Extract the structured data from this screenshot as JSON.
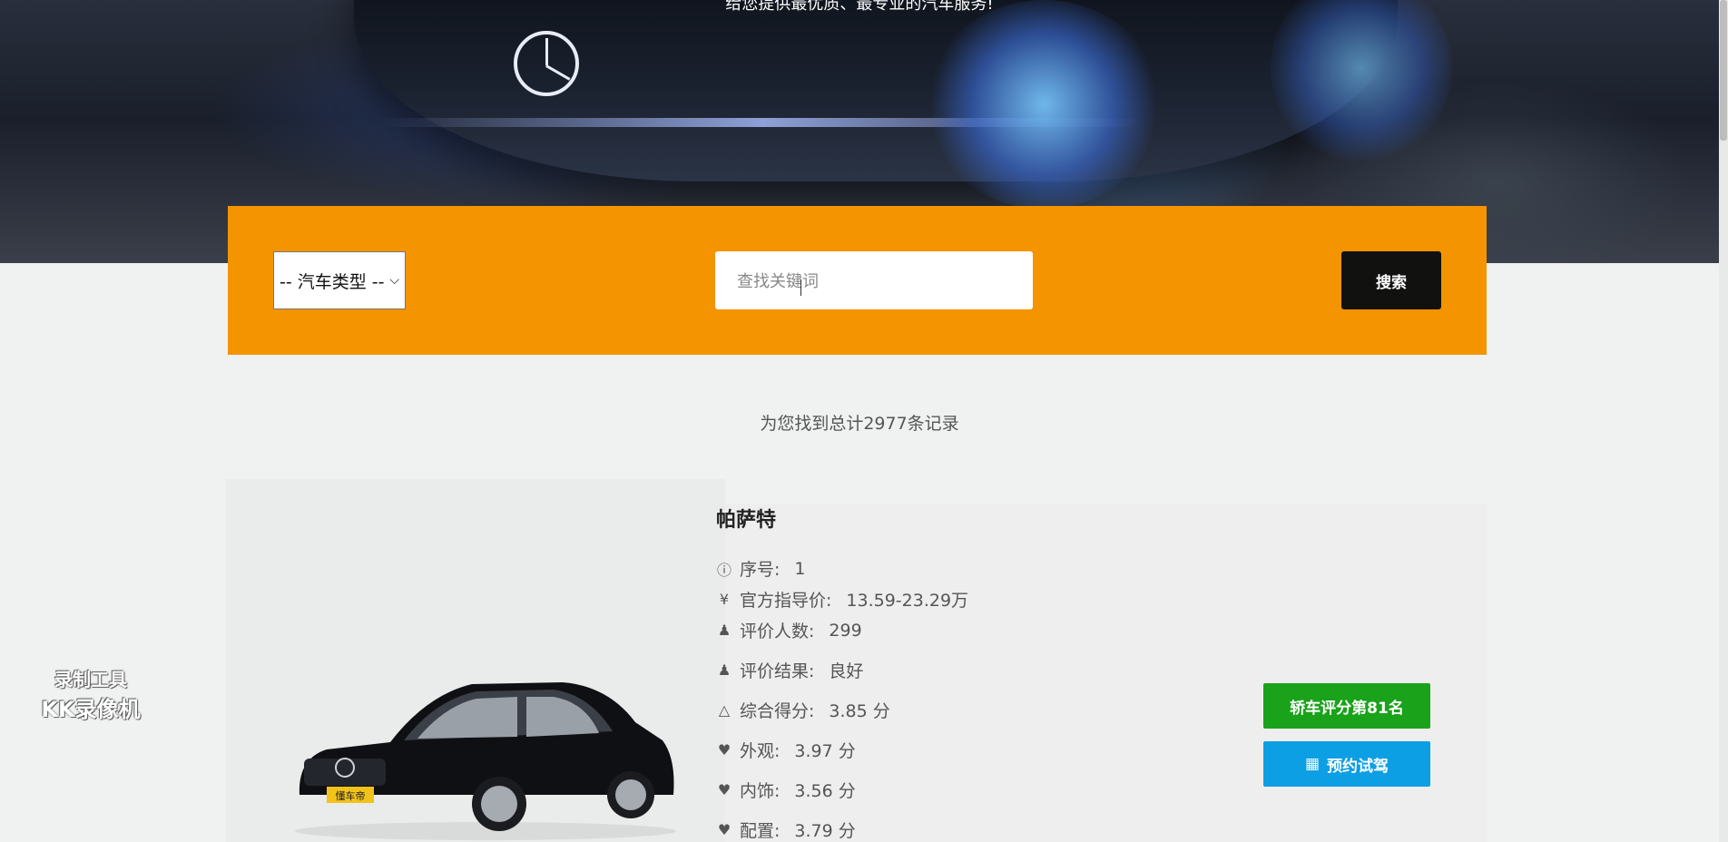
{
  "hero": {
    "subtitle": "给您提供最优质、最专业的汽车服务!"
  },
  "search": {
    "type_select": "-- 汽车类型 --",
    "keyword_placeholder": "查找关键词",
    "button_label": "搜索"
  },
  "result": {
    "count_text": "为您找到总计2977条记录"
  },
  "card": {
    "name": "帕萨特",
    "rows": [
      {
        "icon": "info-icon",
        "label": "序号:",
        "value": "1"
      },
      {
        "icon": "yen-icon",
        "label": "官方指导价:",
        "value": "13.59-23.29万"
      },
      {
        "icon": "user-icon",
        "label": "评价人数:",
        "value": "299"
      },
      {
        "icon": "user-icon",
        "label": "评价结果:",
        "value": "良好"
      },
      {
        "icon": "graduation-cap-icon",
        "label": "综合得分:",
        "value": "3.85 分"
      },
      {
        "icon": "heart-icon",
        "label": "外观:",
        "value": "3.97 分"
      },
      {
        "icon": "heart-icon",
        "label": "内饰:",
        "value": "3.56 分"
      },
      {
        "icon": "heart-icon",
        "label": "配置:",
        "value": "3.79 分"
      }
    ],
    "rank_label": "轿车评分第81名",
    "test_drive_label": "预约试驾",
    "photo_plate": "懂车帝"
  },
  "watermark": {
    "line1": "录制工具",
    "line2": "KK录像机"
  },
  "colors": {
    "search_bar": "#f39400",
    "search_button": "#111210",
    "rank_badge": "#1aa21a",
    "test_drive": "#0d9fe4"
  }
}
